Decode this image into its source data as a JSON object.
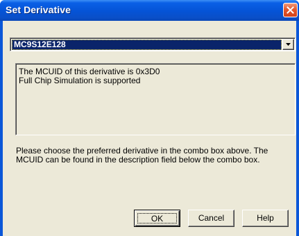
{
  "window": {
    "title": "Set Derivative"
  },
  "combo": {
    "selected": "MC9S12E128"
  },
  "description": {
    "line1": "The MCUID of this derivative is 0x3D0",
    "line2": "Full Chip Simulation is supported"
  },
  "hint": {
    "text": "Please choose the preferred derivative in the combo box above. The MCUID can be found in the description field below the combo box."
  },
  "buttons": {
    "ok": "OK",
    "cancel": "Cancel",
    "help": "Help"
  },
  "colors": {
    "titlebar": "#0553d6",
    "selection": "#0a246a",
    "face": "#ece9d8",
    "close": "#e3572c"
  }
}
